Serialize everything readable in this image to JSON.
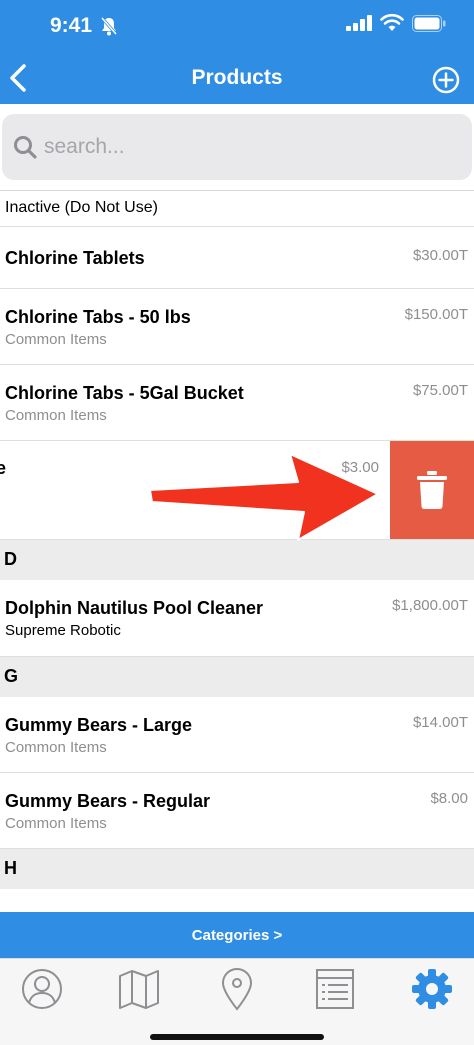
{
  "status_bar": {
    "time": "9:41"
  },
  "nav": {
    "title": "Products"
  },
  "search": {
    "placeholder": "search..."
  },
  "rows": [
    {
      "name": "Inactive (Do Not Use)",
      "sub": "",
      "price": ""
    },
    {
      "name": "Chlorine Tablets",
      "sub": "",
      "price": "$30.00T"
    },
    {
      "name": "Chlorine Tabs - 50 lbs",
      "sub": "Common Items",
      "price": "$150.00T"
    },
    {
      "name": "Chlorine Tabs - 5Gal Bucket",
      "sub": "Common Items",
      "price": "$75.00T"
    },
    {
      "name": "e",
      "sub": "",
      "price": "$3.00"
    },
    {
      "section": "D"
    },
    {
      "name": "Dolphin Nautilus Pool Cleaner",
      "sub": "Supreme Robotic",
      "price": "$1,800.00T"
    },
    {
      "section": "G"
    },
    {
      "name": "Gummy Bears - Large",
      "sub": "Common Items",
      "price": "$14.00T"
    },
    {
      "name": "Gummy Bears - Regular",
      "sub": "Common Items",
      "price": "$8.00"
    },
    {
      "section": "H"
    }
  ],
  "bottom": {
    "categories_label": "Categories >"
  },
  "tabs": [
    {
      "icon": "profile-icon"
    },
    {
      "icon": "map-icon"
    },
    {
      "icon": "location-pin-icon"
    },
    {
      "icon": "list-icon"
    },
    {
      "icon": "gear-icon",
      "active": true
    }
  ],
  "colors": {
    "header": "#2f8de4",
    "delete": "#e65b44",
    "arrow": "#f0321e",
    "active_tab": "#2f8de4",
    "inactive_tab": "#8e8e93"
  }
}
